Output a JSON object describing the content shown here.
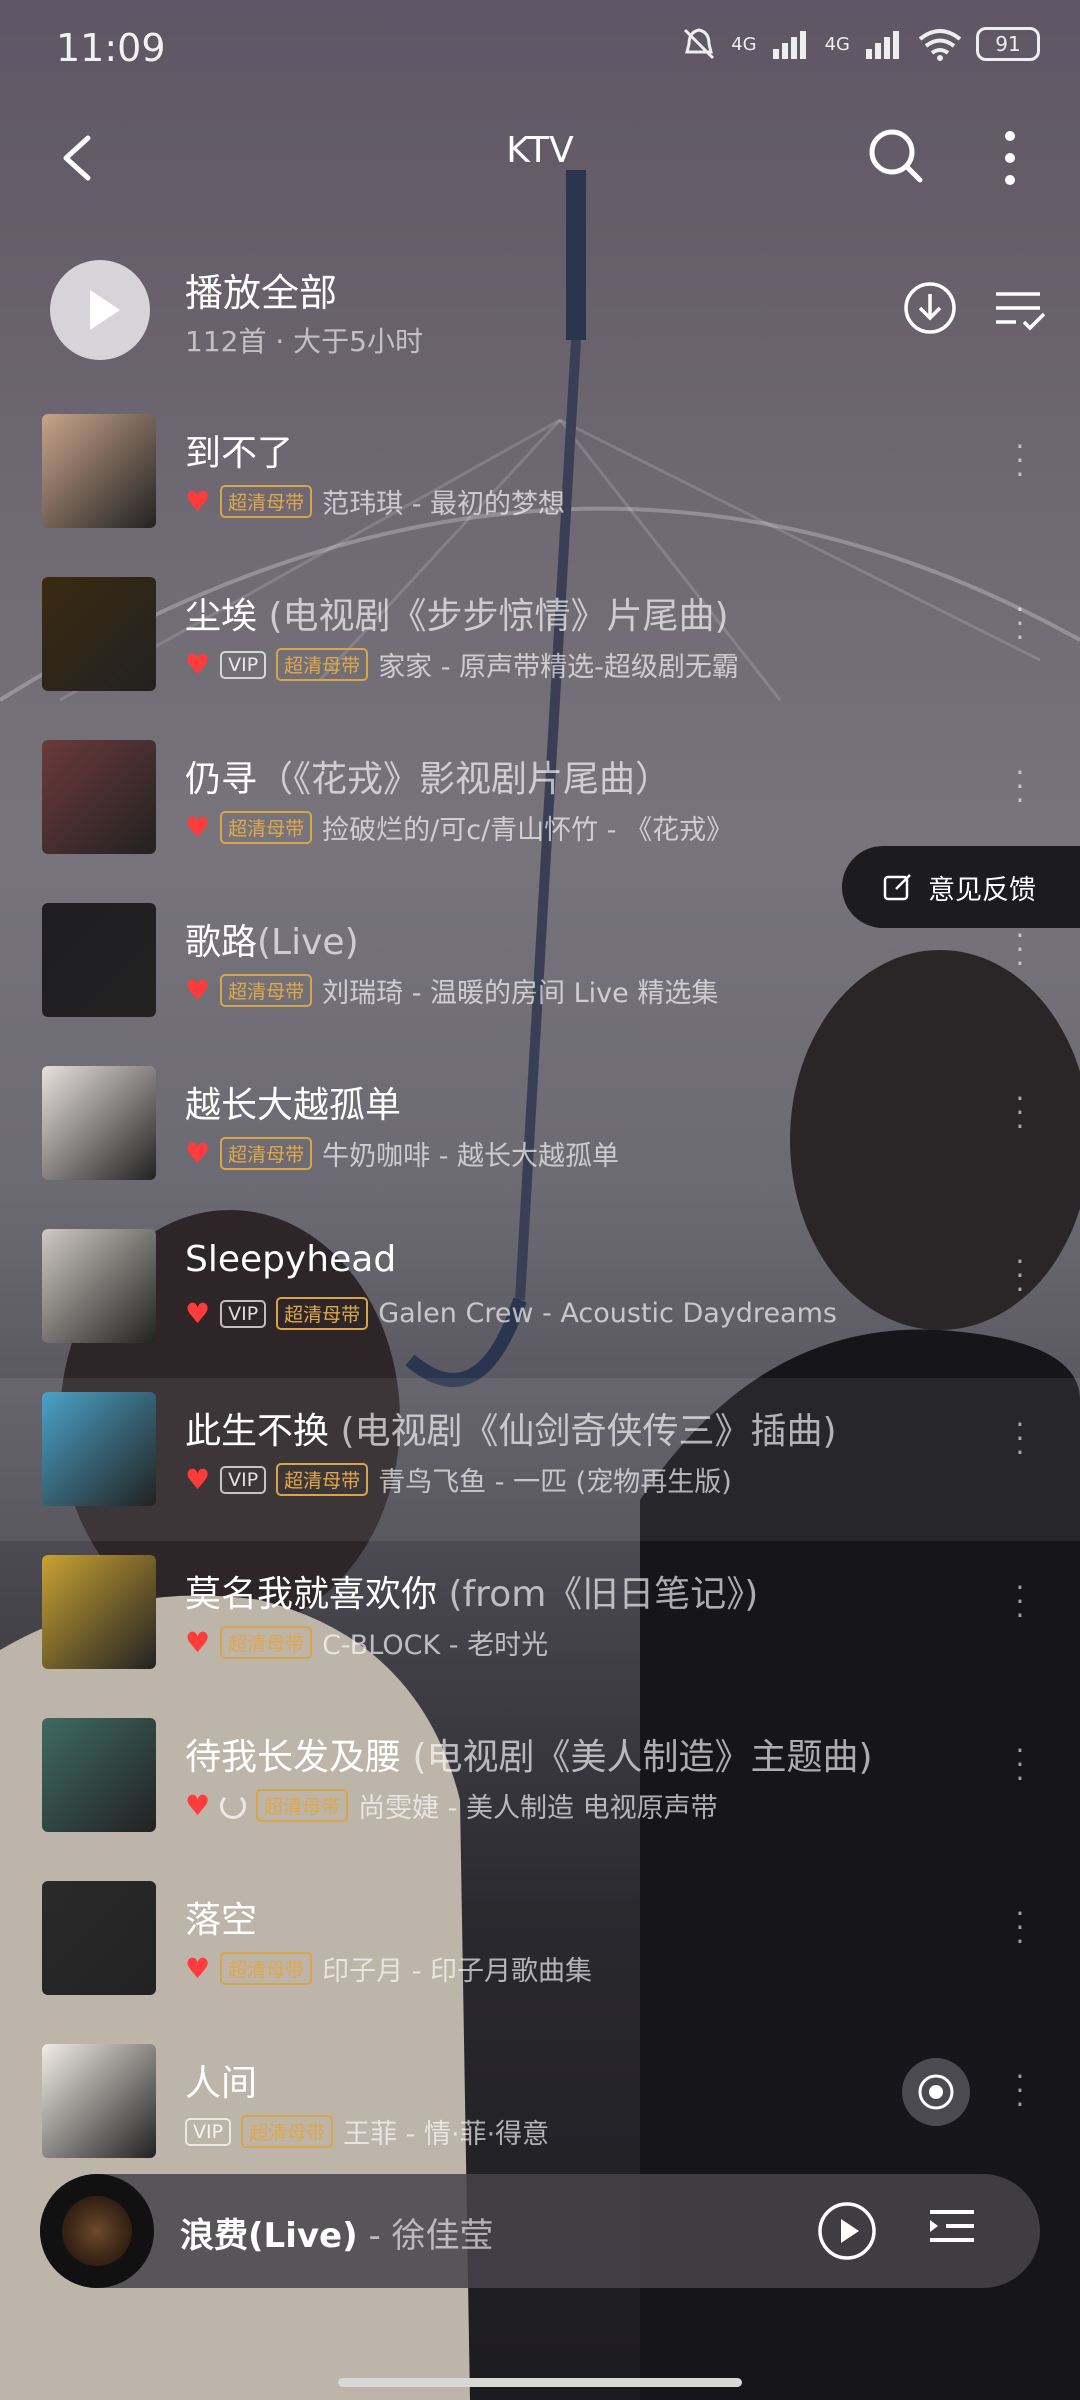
{
  "status": {
    "time": "11:09",
    "signal1": "4G",
    "signal2": "4G",
    "battery": "91"
  },
  "header": {
    "title": "KTV"
  },
  "playall": {
    "label": "播放全部",
    "sub": "112首 · 大于5小时"
  },
  "feedback": {
    "label": "意见反馈"
  },
  "songs": [
    {
      "title": "到不了",
      "alt": "",
      "liked": true,
      "vip": false,
      "hq": "超清母带",
      "loading": false,
      "artist": "范玮琪 - 最初的梦想",
      "cover": "#c9a48c"
    },
    {
      "title": "尘埃",
      "alt": " (电视剧《步步惊情》片尾曲)",
      "liked": true,
      "vip": true,
      "hq": "超清母带",
      "loading": false,
      "artist": "家家 - 原声带精选-超级剧无霸",
      "cover": "#3a2a10"
    },
    {
      "title": "仍寻",
      "alt": "（《花戎》影视剧片尾曲）",
      "liked": true,
      "vip": false,
      "hq": "超清母带",
      "loading": false,
      "artist": "捡破烂的/可c/青山怀竹 - 《花戎》",
      "cover": "#6b3a3a"
    },
    {
      "title": "歌路",
      "alt": "(Live)",
      "liked": true,
      "vip": false,
      "hq": "超清母带",
      "loading": false,
      "artist": "刘瑞琦 - 温暖的房间 Live 精选集",
      "cover": "#1e1e22"
    },
    {
      "title": "越长大越孤单",
      "alt": "",
      "liked": true,
      "vip": false,
      "hq": "超清母带",
      "loading": false,
      "artist": "牛奶咖啡 - 越长大越孤单",
      "cover": "#e8e2de"
    },
    {
      "title": "Sleepyhead",
      "alt": "",
      "liked": true,
      "vip": true,
      "hq": "超清母带",
      "loading": false,
      "artist": "Galen Crew - Acoustic Daydreams",
      "cover": "#cfcac2"
    },
    {
      "title": "此生不换",
      "alt": " (电视剧《仙剑奇侠传三》插曲)",
      "liked": true,
      "vip": true,
      "hq": "超清母带",
      "loading": false,
      "artist": "青鸟飞鱼 - 一匹 (宠物再生版)",
      "cover": "#4aa3c8"
    },
    {
      "title": "莫名我就喜欢你",
      "alt": " (from《旧日笔记》)",
      "liked": true,
      "vip": false,
      "hq": "超清母带",
      "loading": false,
      "artist": "C-BLOCK - 老时光",
      "cover": "#c9a233"
    },
    {
      "title": "待我长发及腰",
      "alt": " (电视剧《美人制造》主题曲)",
      "liked": true,
      "vip": false,
      "hq": "超清母带",
      "loading": true,
      "artist": "尚雯婕 - 美人制造 电视原声带",
      "cover": "#3f6a63"
    },
    {
      "title": "落空",
      "alt": "",
      "liked": true,
      "vip": false,
      "hq": "超清母带",
      "loading": false,
      "artist": "印子月 - 印子月歌曲集",
      "cover": "#2a2a2a"
    },
    {
      "title": "人间",
      "alt": "",
      "liked": false,
      "vip": true,
      "hq": "超清母带",
      "loading": false,
      "artist": "王菲 - 情·菲·得意",
      "cover": "#f2ede6"
    }
  ],
  "highlight_index": 6,
  "now_playing": {
    "title": "浪费(Live)",
    "artist": "- 徐佳莹"
  },
  "colors": {
    "heart": "#ff3b3b",
    "hq_badge": "#e0a84a"
  }
}
